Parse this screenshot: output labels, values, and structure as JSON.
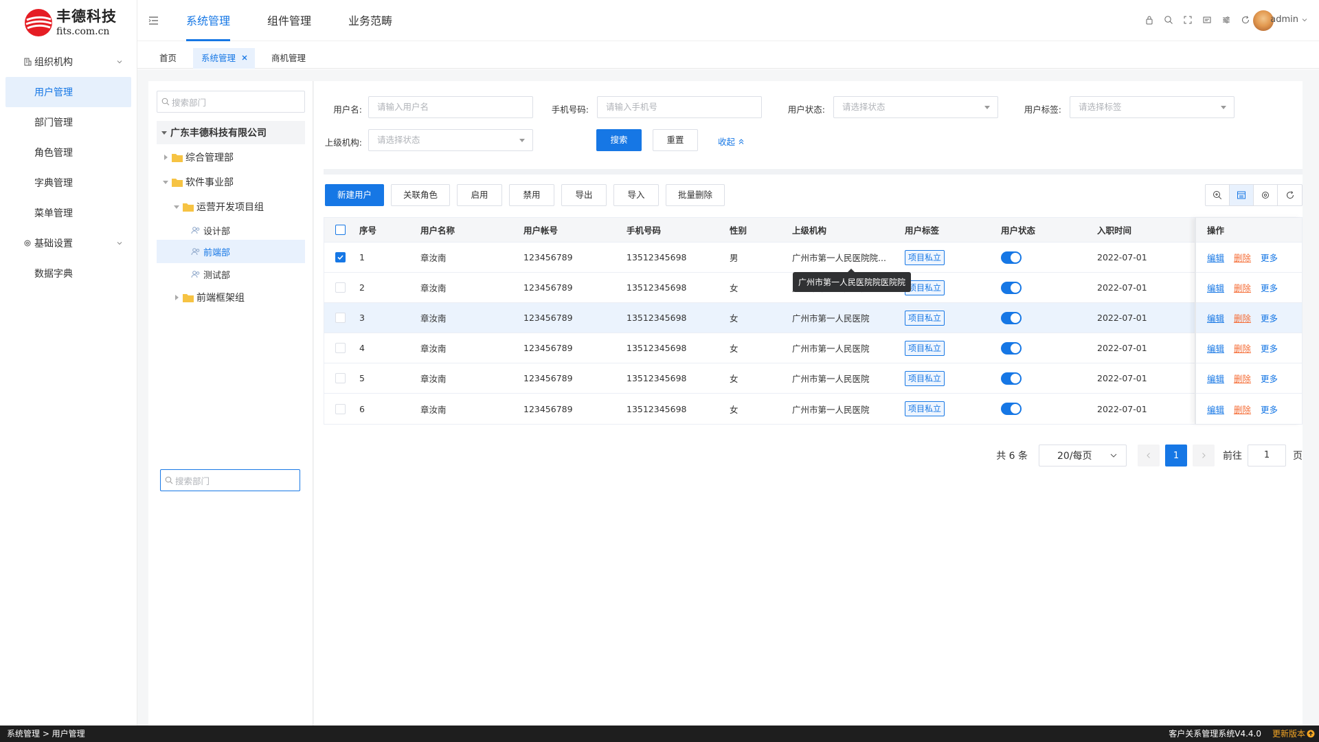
{
  "brand": {
    "name_cn": "丰德科技",
    "name_en": "fits.com.cn"
  },
  "sidebar": {
    "groups": [
      {
        "label": "组织机构",
        "icon": "building-icon",
        "items": [
          {
            "label": "用户管理",
            "active": true
          },
          {
            "label": "部门管理"
          },
          {
            "label": "角色管理"
          },
          {
            "label": "字典管理"
          },
          {
            "label": "菜单管理"
          }
        ]
      },
      {
        "label": "基础设置",
        "icon": "gear-icon",
        "items": [
          {
            "label": "数据字典"
          }
        ]
      }
    ]
  },
  "header": {
    "nav": [
      {
        "label": "系统管理",
        "active": true
      },
      {
        "label": "组件管理"
      },
      {
        "label": "业务范畴"
      }
    ],
    "icons": [
      "lock-icon",
      "search-icon",
      "fullscreen-icon",
      "message-icon",
      "settings-sliders-icon",
      "refresh-icon"
    ],
    "user": "admin"
  },
  "tabs": [
    {
      "label": "首页"
    },
    {
      "label": "系统管理",
      "active": true,
      "closable": true
    },
    {
      "label": "商机管理"
    }
  ],
  "tree": {
    "search_placeholder": "搜索部门",
    "root": "广东丰德科技有限公司",
    "nodes": [
      "综合管理部",
      "软件事业部",
      "运营开发项目组",
      "设计部",
      "前端部",
      "测试部",
      "前端框架组"
    ],
    "selected": "前端部"
  },
  "filters": {
    "username_label": "用户名:",
    "username_placeholder": "请输入用户名",
    "phone_label": "手机号码:",
    "phone_placeholder": "请输入手机号",
    "status_label": "用户状态:",
    "status_placeholder": "请选择状态",
    "tag_label": "用户标签:",
    "tag_placeholder": "请选择标签",
    "org_label": "上级机构:",
    "org_placeholder": "请选择状态",
    "search_btn": "搜索",
    "reset_btn": "重置",
    "collapse": "收起"
  },
  "toolbar": {
    "buttons": [
      "新建用户",
      "关联角色",
      "启用",
      "禁用",
      "导出",
      "导入",
      "批量删除"
    ],
    "tools": [
      "zoom-icon",
      "table-density-icon",
      "column-settings-icon",
      "refresh-icon"
    ]
  },
  "table": {
    "columns": [
      "序号",
      "用户名称",
      "用户帐号",
      "手机号码",
      "性别",
      "上级机构",
      "用户标签",
      "用户状态",
      "入职时间",
      "操作"
    ],
    "rows": [
      {
        "no": "1",
        "name": "章汝南",
        "account": "123456789",
        "phone": "13512345698",
        "gender": "男",
        "org": "广州市第一人民医院院...",
        "tag": "项目私立",
        "status": true,
        "date": "2022-07-01",
        "checked": true
      },
      {
        "no": "2",
        "name": "章汝南",
        "account": "123456789",
        "phone": "13512345698",
        "gender": "女",
        "org": "广州市第一人民医院",
        "tag": "项目私立",
        "status": true,
        "date": "2022-07-01"
      },
      {
        "no": "3",
        "name": "章汝南",
        "account": "123456789",
        "phone": "13512345698",
        "gender": "女",
        "org": "广州市第一人民医院",
        "tag": "项目私立",
        "status": true,
        "date": "2022-07-01",
        "highlight": true
      },
      {
        "no": "4",
        "name": "章汝南",
        "account": "123456789",
        "phone": "13512345698",
        "gender": "女",
        "org": "广州市第一人民医院",
        "tag": "项目私立",
        "status": true,
        "date": "2022-07-01"
      },
      {
        "no": "5",
        "name": "章汝南",
        "account": "123456789",
        "phone": "13512345698",
        "gender": "女",
        "org": "广州市第一人民医院",
        "tag": "项目私立",
        "status": true,
        "date": "2022-07-01"
      },
      {
        "no": "6",
        "name": "章汝南",
        "account": "123456789",
        "phone": "13512345698",
        "gender": "女",
        "org": "广州市第一人民医院",
        "tag": "项目私立",
        "status": true,
        "date": "2022-07-01"
      }
    ],
    "ops": {
      "edit": "编辑",
      "delete": "删除",
      "more": "更多"
    },
    "tooltip": "广州市第一人民医院院医院院"
  },
  "pager": {
    "total": "共 6 条",
    "size": "20/每页",
    "current": "1",
    "goto": "前往",
    "jump_value": "1",
    "page_unit": "页"
  },
  "footer": {
    "breadcrumb": "系统管理 > 用户管理",
    "version": "客户关系管理系统V4.4.0",
    "update": "更新版本"
  },
  "colors": {
    "accent": "#1677e5",
    "danger": "#f56c35",
    "warning": "#f5a623"
  }
}
